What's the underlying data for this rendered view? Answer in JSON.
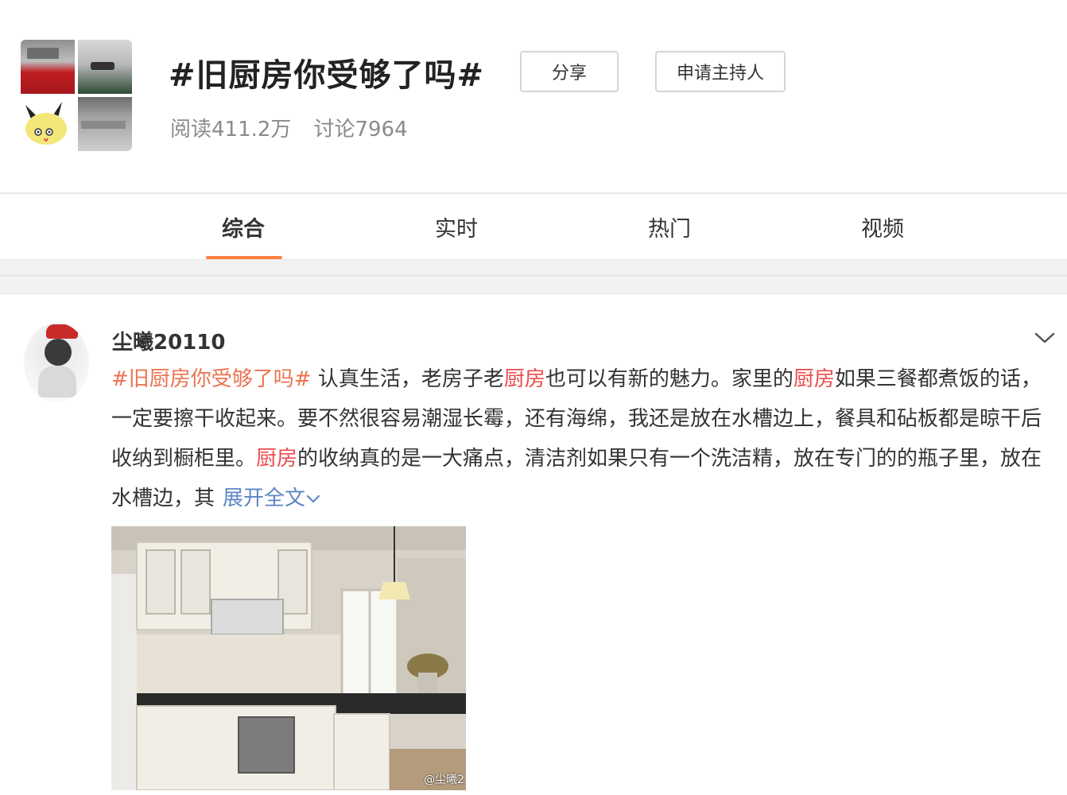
{
  "header": {
    "title": "#旧厨房你受够了吗#",
    "stats": {
      "reads": "阅读411.2万",
      "discussions": "讨论7964"
    },
    "share_label": "分享",
    "host_label": "申请主持人"
  },
  "tabs": [
    {
      "label": "综合",
      "active": true
    },
    {
      "label": "实时",
      "active": false
    },
    {
      "label": "热门",
      "active": false
    },
    {
      "label": "视频",
      "active": false
    }
  ],
  "post": {
    "username": "尘曦20110",
    "hashtag": "#旧厨房你受够了吗#",
    "text_1": " 认真生活，老房子老",
    "keyword": "厨房",
    "text_2": "也可以有新的魅力。家里的",
    "text_3": "如果三餐都煮饭的话，一定要擦干收起来。要不然很容易潮湿长霉，还有海绵，我还是放在水槽边上，餐具和砧板都是晾干后收纳到橱柜里。",
    "text_4": "的收纳真的是一大痛点，清洁剂如果只有一个洗洁精，放在专门的的瓶子里，放在水槽边，其",
    "expand_label": "展开全文",
    "image_watermark": "@尘曦2"
  },
  "colors": {
    "hashtag": "#eb7350",
    "keyword": "#eb4c4c",
    "link": "#5d86c5",
    "tab_underline": "#ff8140"
  }
}
